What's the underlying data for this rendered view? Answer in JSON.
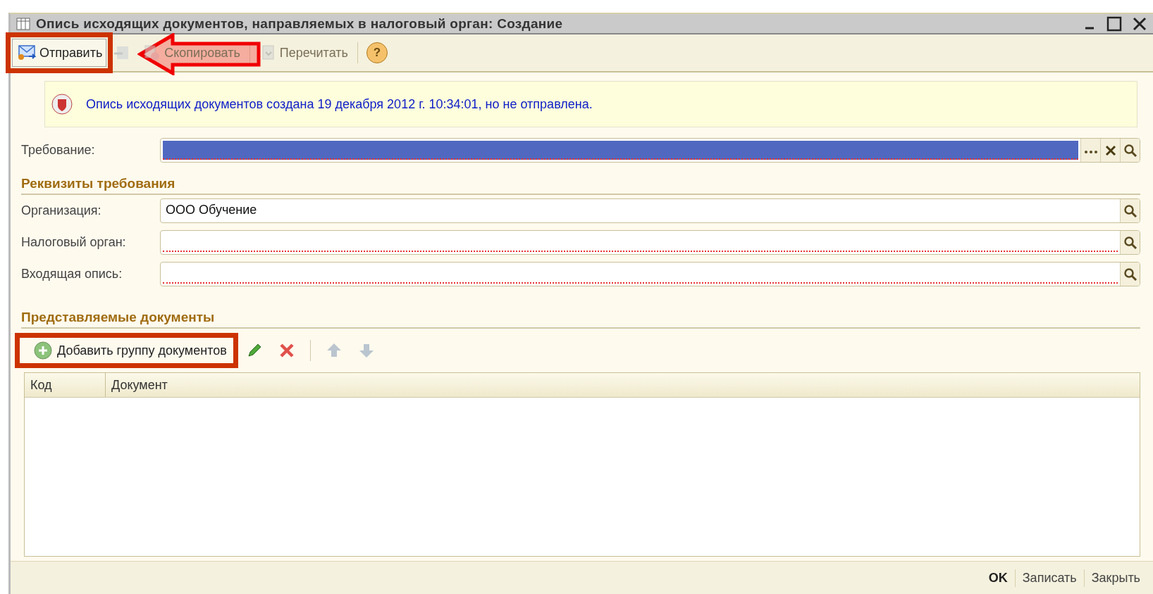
{
  "window": {
    "title": "Опись исходящих документов, направляемых в налоговый орган: Создание"
  },
  "toolbar": [
    {
      "kind": "button",
      "label": "Отправить",
      "disabled": false,
      "highlighted": true
    },
    {
      "kind": "button",
      "disabled": true,
      "highlighted": false
    },
    {
      "kind": "button",
      "label": "Скопировать",
      "disabled": true,
      "highlighted": false
    },
    {
      "kind": "separator"
    },
    {
      "kind": "button",
      "label": "Перечитать",
      "disabled": true,
      "highlighted": false
    },
    {
      "kind": "separator"
    },
    {
      "kind": "help",
      "label": "?",
      "disabled": false,
      "highlighted": false
    }
  ],
  "pointer_arrow": true,
  "info": {
    "message": "Опись исходящих документов создана 19 декабря 2012 г. 10:34:01, но не отправлена."
  },
  "request_field": {
    "kind": "choice",
    "label": "Требование:",
    "selected": true,
    "invalid": true
  },
  "sections": [
    {
      "title": "Реквизиты требования",
      "fields": [
        {
          "kind": "lookup",
          "label": "Организация:",
          "value": "ООО Обучение",
          "selected": false,
          "invalid": false
        },
        {
          "kind": "lookup",
          "label": "Налоговый орган:",
          "selected": false,
          "invalid": true
        },
        {
          "kind": "lookup",
          "label": "Входящая опись:",
          "selected": false,
          "invalid": true
        }
      ]
    },
    {
      "title": "Представляемые документы"
    }
  ],
  "documents_toolbar": [
    {
      "kind": "button",
      "label": "Добавить группу документов",
      "disabled": false,
      "highlighted": true
    },
    {
      "kind": "button",
      "disabled": false,
      "highlighted": false
    },
    {
      "kind": "button",
      "disabled": false,
      "highlighted": false
    },
    {
      "kind": "separator"
    },
    {
      "kind": "button",
      "disabled": true,
      "highlighted": false
    },
    {
      "kind": "button",
      "disabled": true,
      "highlighted": false
    }
  ],
  "table": {
    "columns": [
      "Код",
      "Документ"
    ]
  },
  "footer_buttons": [
    {
      "label": "OK",
      "default": true
    },
    {
      "label": "Записать",
      "default": false
    },
    {
      "label": "Закрыть",
      "default": false
    }
  ]
}
